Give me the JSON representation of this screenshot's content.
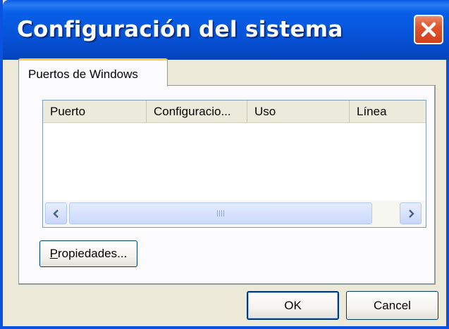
{
  "window": {
    "title": "Configuración del sistema",
    "close_icon": "close-icon"
  },
  "tabs": [
    {
      "label": "Puertos de Windows",
      "selected": true
    }
  ],
  "list": {
    "columns": [
      "Puerto",
      "Configuracio...",
      "Uso",
      "Línea"
    ],
    "rows": [],
    "scroll_left_icon": "chevron-left-icon",
    "scroll_right_icon": "chevron-right-icon"
  },
  "properties_button": {
    "mnemonic": "P",
    "rest": "ropiedades..."
  },
  "footer": {
    "ok_label": "OK",
    "cancel_label": "Cancel"
  },
  "colors": {
    "titlebar": "#0653d8",
    "close": "#e0552d",
    "dialog": "#ece9d8",
    "tab_accent": "#ffc83c"
  }
}
